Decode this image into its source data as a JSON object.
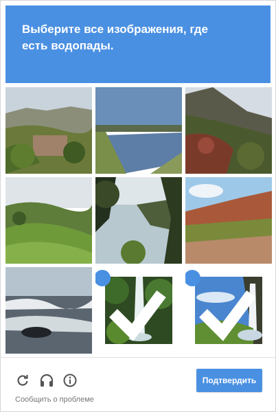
{
  "header": {
    "line1": "Выберите все изображения, где",
    "line2_prefix": "есть ",
    "line2_target": "водопады",
    "line2_suffix": "."
  },
  "tiles": [
    {
      "name": "tile-village-hills",
      "icon": "landscape-image",
      "selected": false
    },
    {
      "name": "tile-river",
      "icon": "landscape-image",
      "selected": false
    },
    {
      "name": "tile-mountain-forest",
      "icon": "landscape-image",
      "selected": false
    },
    {
      "name": "tile-green-hills",
      "icon": "landscape-image",
      "selected": false
    },
    {
      "name": "tile-coastal-trees",
      "icon": "landscape-image",
      "selected": false
    },
    {
      "name": "tile-desert-canyon",
      "icon": "landscape-image",
      "selected": false
    },
    {
      "name": "tile-sea-waves",
      "icon": "landscape-image",
      "selected": false
    },
    {
      "name": "tile-waterfall-forest",
      "icon": "landscape-image",
      "selected": true
    },
    {
      "name": "tile-waterfall-cliff",
      "icon": "landscape-image",
      "selected": true
    }
  ],
  "toolbar": {
    "reload_icon": "reload-icon",
    "audio_icon": "headphones-icon",
    "info_icon": "info-icon",
    "verify_label": "Подтвердить",
    "report_label": "Сообщить о проблеме"
  },
  "colors": {
    "accent": "#4a90e2",
    "icon_gray": "#555555"
  }
}
